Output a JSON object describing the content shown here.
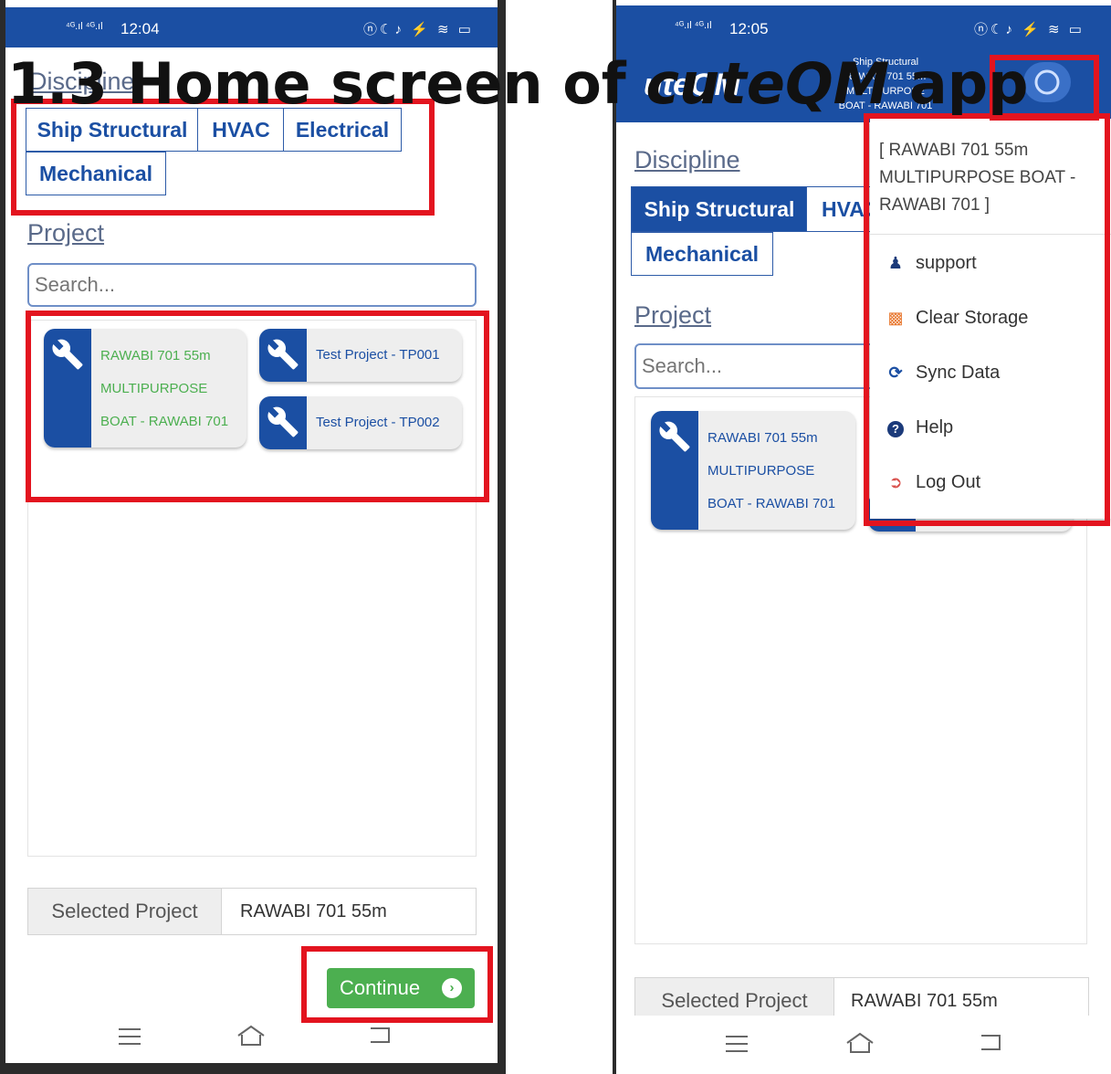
{
  "headline": {
    "part1": "1.3 Home screen of ",
    "italic": "cuteQM",
    "part2": " app"
  },
  "left": {
    "status": {
      "signal": "⁴ᴳ.ıl ⁴ᴳ.ıl",
      "time": "12:04",
      "icons": "ⓝ☾♪ ⚡ ≋ ▭"
    },
    "discipline_label": "Discipline",
    "disciplines": [
      "Ship Structural",
      "HVAC",
      "Electrical",
      "Mechanical"
    ],
    "project_label": "Project",
    "search_placeholder": "Search...",
    "cards": [
      {
        "lines": [
          "RAWABI 701 55m",
          "MULTIPURPOSE",
          "BOAT - RAWABI 701"
        ]
      },
      {
        "lines": [
          "Test Project - TP001"
        ]
      },
      {
        "lines": [
          "Test Project - TP002"
        ]
      }
    ],
    "selected_label": "Selected Project",
    "selected_value": "RAWABI 701 55m",
    "continue_label": "Continue"
  },
  "right": {
    "status": {
      "signal": "⁴ᴳ.ıl ⁴ᴳ.ıl",
      "time": "12:05",
      "icons": "ⓝ☾♪ ⚡ ≋ ▭"
    },
    "appbar_title_fragment": "uteQM",
    "appbar_subtitle_lines": [
      "Ship Structural",
      "RAWABI 701 55m MULTIPURPOSE",
      "BOAT - RAWABI 701"
    ],
    "discipline_label": "Discipline",
    "disciplines": [
      "Ship Structural",
      "HVAC",
      "Mechanical"
    ],
    "project_label": "Project",
    "search_placeholder": "Search...",
    "cards": [
      {
        "lines": [
          "RAWABI 701 55m",
          "MULTIPURPOSE",
          "BOAT - RAWABI 701"
        ]
      }
    ],
    "selected_label": "Selected Project",
    "selected_value": "RAWABI 701 55m",
    "menu": {
      "header": "[ RAWABI 701 55m MULTIPURPOSE BOAT - RAWABI 701 ]",
      "items": [
        {
          "label": "support",
          "icon": "user-icon",
          "color": "#1b3a7a"
        },
        {
          "label": "Clear Storage",
          "icon": "trash-icon",
          "color": "#e8772e"
        },
        {
          "label": "Sync Data",
          "icon": "sync-icon",
          "color": "#1b4fa3"
        },
        {
          "label": "Help",
          "icon": "help-icon",
          "color": "#1b3a7a"
        },
        {
          "label": "Log Out",
          "icon": "logout-icon",
          "color": "#d9534f"
        }
      ]
    }
  },
  "colors": {
    "primary": "#1b4fa3",
    "success": "#4caf50",
    "highlight": "#e3141f"
  }
}
